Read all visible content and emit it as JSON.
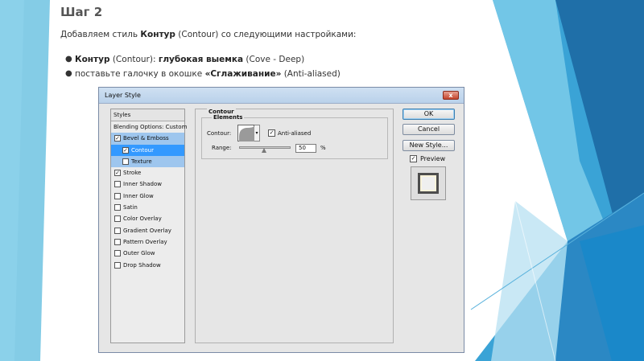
{
  "slide": {
    "title": "Шаг 2",
    "intro_prefix": "Добавляем стиль ",
    "intro_bold": "Контур",
    "intro_suffix": " (Contour) со следующими настройками:",
    "bullet_glyph": "●",
    "bullet1_bold1": "Контур",
    "bullet1_mid": " (Contour): ",
    "bullet1_bold2": "глубокая выемка",
    "bullet1_suffix": " (Cove - Deep)",
    "bullet2_prefix": "поставьте галочку в окошке ",
    "bullet2_bold": "«Сглаживание»",
    "bullet2_suffix": " (Anti-aliased)"
  },
  "dialog": {
    "title": "Layer Style",
    "close_glyph": "x",
    "styles_header": "Styles",
    "check_glyph": "✓",
    "items": [
      {
        "label": "Blending Options: Custom"
      },
      {
        "label": "Bevel & Emboss",
        "checked": true
      },
      {
        "label": "Contour",
        "checked": true
      },
      {
        "label": "Texture",
        "checked": false
      },
      {
        "label": "Stroke",
        "checked": true
      },
      {
        "label": "Inner Shadow",
        "checked": false
      },
      {
        "label": "Inner Glow",
        "checked": false
      },
      {
        "label": "Satin",
        "checked": false
      },
      {
        "label": "Color Overlay",
        "checked": false
      },
      {
        "label": "Gradient Overlay",
        "checked": false
      },
      {
        "label": "Pattern Overlay",
        "checked": false
      },
      {
        "label": "Outer Glow",
        "checked": false
      },
      {
        "label": "Drop Shadow",
        "checked": false
      }
    ],
    "group_title": "Contour",
    "subgroup_title": "Elements",
    "contour_label": "Contour:",
    "anti_aliased_label": "Anti-aliased",
    "anti_aliased_checked": true,
    "range_label": "Range:",
    "range_value": "50",
    "range_unit": "%",
    "range_fraction": 0.5,
    "buttons": {
      "ok": "OK",
      "cancel": "Cancel",
      "new_style": "New Style..."
    },
    "preview_label": "Preview",
    "preview_checked": true
  }
}
